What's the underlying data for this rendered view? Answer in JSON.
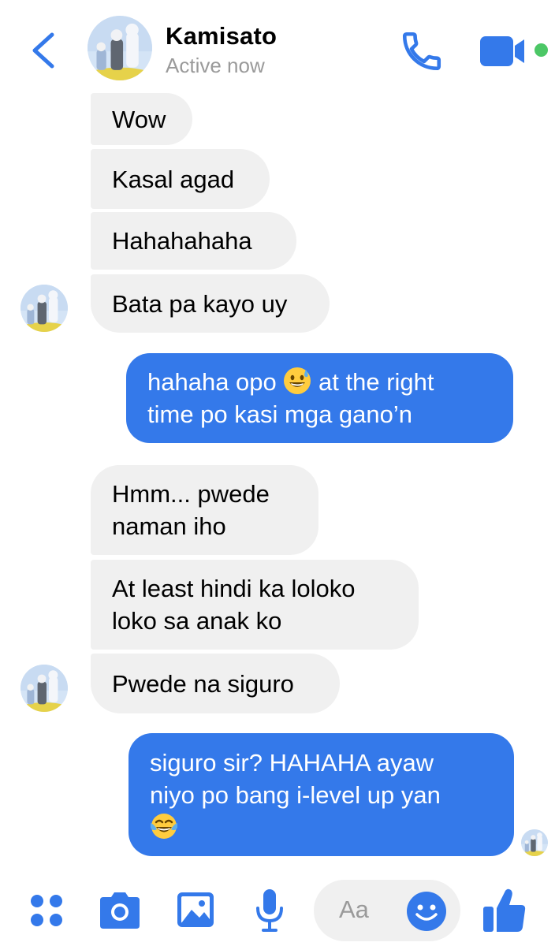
{
  "header": {
    "contact_name": "Kamisato",
    "status": "Active now"
  },
  "messages": [
    {
      "direction": "incoming",
      "text": "Wow"
    },
    {
      "direction": "incoming",
      "text": "Kasal agad"
    },
    {
      "direction": "incoming",
      "text": "Hahahahaha"
    },
    {
      "direction": "incoming",
      "text": "Bata pa kayo uy"
    },
    {
      "direction": "outgoing",
      "line1_a": "hahaha opo",
      "emoji": "grinning-face-with-sweat",
      "line1_b": "at the right",
      "line2": "time po kasi mga gano’n"
    },
    {
      "direction": "incoming",
      "line1": "Hmm... pwede",
      "line2": "naman iho"
    },
    {
      "direction": "incoming",
      "line1": "At least hindi ka loloko",
      "line2": "loko sa anak ko"
    },
    {
      "direction": "incoming",
      "text": "Pwede na siguro"
    },
    {
      "direction": "outgoing",
      "line1": "siguro sir? HAHAHA ayaw",
      "line2": "niyo po bang i-level up yan",
      "emoji": "face-with-tears-of-joy"
    }
  ],
  "composer": {
    "placeholder": "Aa",
    "tools": [
      "menu-grid-icon",
      "camera-icon",
      "gallery-icon",
      "microphone-icon",
      "emoji-icon",
      "thumbs-up-icon"
    ]
  },
  "colors": {
    "accent": "#3479ea",
    "incoming_bubble": "#f0f0f0",
    "online": "#4cc766"
  }
}
